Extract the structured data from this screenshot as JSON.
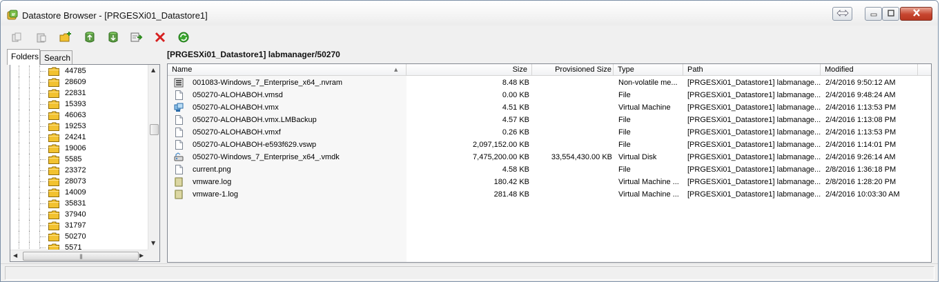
{
  "window": {
    "title": "Datastore Browser - [PRGESXi01_Datastore1]",
    "icon": "datastore-browser-icon",
    "controls": [
      "restore-size-icon",
      "minimize-icon",
      "maximize-icon",
      "close-icon"
    ]
  },
  "toolbar": {
    "buttons": [
      {
        "name": "copy-button",
        "icon": "copy-icon"
      },
      {
        "name": "paste-button",
        "icon": "paste-icon"
      },
      {
        "name": "new-folder-button",
        "icon": "new-folder-icon"
      },
      {
        "name": "upload-button",
        "icon": "upload-icon"
      },
      {
        "name": "download-button",
        "icon": "download-icon"
      },
      {
        "name": "register-vm-button",
        "icon": "register-vm-icon"
      },
      {
        "name": "delete-button",
        "icon": "delete-icon"
      },
      {
        "name": "refresh-button",
        "icon": "refresh-icon"
      }
    ]
  },
  "tabs": [
    {
      "label": "Folders",
      "active": true
    },
    {
      "label": "Search",
      "active": false
    }
  ],
  "tree": {
    "items": [
      "44785",
      "28609",
      "22831",
      "15393",
      "46063",
      "19253",
      "24241",
      "19006",
      "5585",
      "23372",
      "28073",
      "14009",
      "35831",
      "37940",
      "31797",
      "50270",
      "5571"
    ],
    "selected": "50270"
  },
  "path": "[PRGESXi01_Datastore1] labmanager/50270",
  "columns": [
    "Name",
    "Size",
    "Provisioned Size",
    "Type",
    "Path",
    "Modified"
  ],
  "files": [
    {
      "name": "001083-Windows_7_Enterprise_x64_.nvram",
      "icon": "nvram-file-icon",
      "size": "8.48 KB",
      "provisioned": "",
      "type": "Non-volatile me...",
      "path": "[PRGESXi01_Datastore1] labmanage...",
      "modified": "2/4/2016 9:50:12 AM"
    },
    {
      "name": "050270-ALOHABOH.vmsd",
      "icon": "file-icon",
      "size": "0.00 KB",
      "provisioned": "",
      "type": "File",
      "path": "[PRGESXi01_Datastore1] labmanage...",
      "modified": "2/4/2016 9:48:24 AM"
    },
    {
      "name": "050270-ALOHABOH.vmx",
      "icon": "virtual-machine-icon",
      "size": "4.51 KB",
      "provisioned": "",
      "type": "Virtual Machine",
      "path": "[PRGESXi01_Datastore1] labmanage...",
      "modified": "2/4/2016 1:13:53 PM"
    },
    {
      "name": "050270-ALOHABOH.vmx.LMBackup",
      "icon": "file-icon",
      "size": "4.57 KB",
      "provisioned": "",
      "type": "File",
      "path": "[PRGESXi01_Datastore1] labmanage...",
      "modified": "2/4/2016 1:13:08 PM"
    },
    {
      "name": "050270-ALOHABOH.vmxf",
      "icon": "file-icon",
      "size": "0.26 KB",
      "provisioned": "",
      "type": "File",
      "path": "[PRGESXi01_Datastore1] labmanage...",
      "modified": "2/4/2016 1:13:53 PM"
    },
    {
      "name": "050270-ALOHABOH-e593f629.vswp",
      "icon": "file-icon",
      "size": "2,097,152.00 KB",
      "provisioned": "",
      "type": "File",
      "path": "[PRGESXi01_Datastore1] labmanage...",
      "modified": "2/4/2016 1:14:01 PM"
    },
    {
      "name": "050270-Windows_7_Enterprise_x64_.vmdk",
      "icon": "virtual-disk-icon",
      "size": "7,475,200.00 KB",
      "provisioned": "33,554,430.00 KB",
      "type": "Virtual Disk",
      "path": "[PRGESXi01_Datastore1] labmanage...",
      "modified": "2/4/2016 9:26:14 AM"
    },
    {
      "name": "current.png",
      "icon": "file-icon",
      "size": "4.58 KB",
      "provisioned": "",
      "type": "File",
      "path": "[PRGESXi01_Datastore1] labmanage...",
      "modified": "2/8/2016 1:36:18 PM"
    },
    {
      "name": "vmware.log",
      "icon": "log-file-icon",
      "size": "180.42 KB",
      "provisioned": "",
      "type": "Virtual Machine ...",
      "path": "[PRGESXi01_Datastore1] labmanage...",
      "modified": "2/8/2016 1:28:20 PM"
    },
    {
      "name": "vmware-1.log",
      "icon": "log-file-icon",
      "size": "281.48 KB",
      "provisioned": "",
      "type": "Virtual Machine ...",
      "path": "[PRGESXi01_Datastore1] labmanage...",
      "modified": "2/4/2016 10:03:30 AM"
    }
  ],
  "colors": {
    "window_border": "#7a8ea5",
    "folder_yellow": "#f2c230",
    "delete_red": "#d62020",
    "refresh_green": "#3aa62e",
    "close_red": "#c7452f"
  }
}
